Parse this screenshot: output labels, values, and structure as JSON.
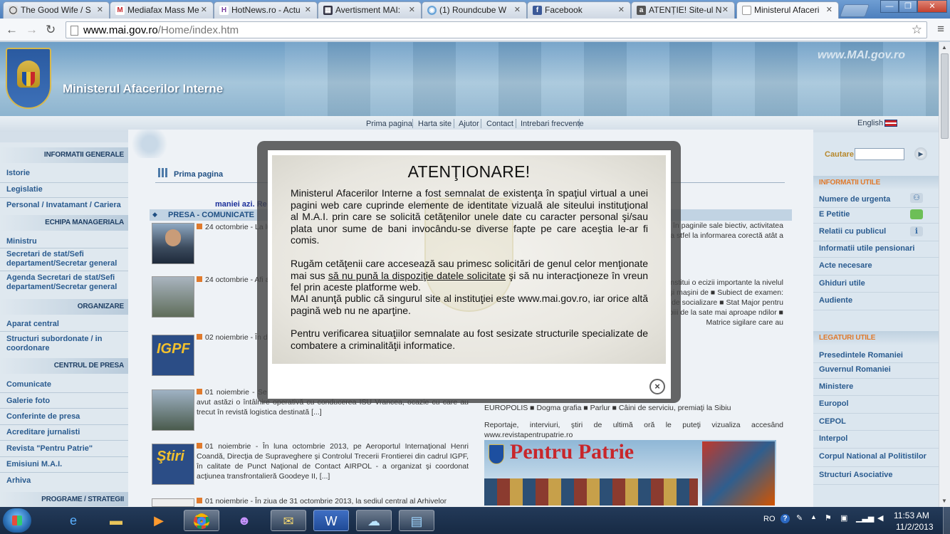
{
  "browser": {
    "tabs": [
      {
        "label": "The Good Wife / S",
        "icon": "speech-icon"
      },
      {
        "label": "Mediafax Mass Me",
        "icon": "gmail-icon"
      },
      {
        "label": "HotNews.ro - Actu",
        "icon": "hotnews-icon"
      },
      {
        "label": "Avertisment MAI:",
        "icon": "news-icon"
      },
      {
        "label": "(1) Roundcube W",
        "icon": "roundcube-icon"
      },
      {
        "label": "Facebook",
        "icon": "facebook-icon"
      },
      {
        "label": "ATENȚIE! Site-ul N",
        "icon": "a-icon"
      },
      {
        "label": "Ministerul Afaceri",
        "icon": "page-icon"
      }
    ],
    "url_host": "www.mai.gov.ro",
    "url_path": "/Home/index.htm"
  },
  "site": {
    "title": "Ministerul Afacerilor Interne",
    "mark": "www.MAI.gov.ro",
    "topnav": [
      "Prima pagina",
      "Harta site",
      "Ajutor",
      "Contact",
      "Intrebari frecvente"
    ],
    "language": "English"
  },
  "leftbar": {
    "h1": "INFORMATII GENERALE",
    "items1": [
      "Istorie",
      "Legislatie",
      "Personal / Invatamant / Cariera"
    ],
    "h2": "ECHIPA MANAGERIALA",
    "items2": [
      "Ministru",
      "Secretari de stat/Sefi departament/Secretar general",
      "Agenda Secretari de stat/Sefi departament/Secretar general"
    ],
    "h3": "ORGANIZARE",
    "items3": [
      "Aparat central",
      "Structuri subordonate / in coordonare"
    ],
    "h4": "CENTRUL DE PRESA",
    "items4": [
      "Comunicate",
      "Galerie foto",
      "Conferinte de presa",
      "Acreditare jurnalisti",
      "Revista \"Pentru Patrie\"",
      "Emisiuni M.A.I.",
      "Arhiva"
    ],
    "h5": "PROGRAME / STRATEGII"
  },
  "center": {
    "breadcrumb": "Prima pagina",
    "marquee": "maniei azi. Re",
    "press_heading": "PRESA - COMUNICATE",
    "news": [
      "24 octombrie - La lucrările Convocării Brigăzilor de Combat de Poliţie Transport",
      "24 octombrie - Afi a şefilor de poliţie d Centrul Chinologic antrenează câinii folo",
      "02 noiembrie - În dispărute sau pe nu au fost depistate activităţilor desfăşura",
      "01 noiembrie - Se şeful Inspectoratului General pentru Situaţii de Urgenţă au avut astăzi o întâlnire operativă cu conducerea ISU Vrancea, ocazie cu care au trecut în revistă logistica destinată [...]",
      "01 noiembrie - În luna octombrie 2013, pe Aeroportul Internaţional Henri Coandă, Direcţia de Supraveghere şi Controlul Trecerii Frontierei din cadrul IGPF, în calitate de Punct Naţional de Contact AIRPOL - a organizat şi coordonat acţiunea transfrontalieră Goodeye II, [...]",
      "01 noiembrie - În ziua de 31 octombrie 2013, la sediul central al Arhivelor"
    ],
    "rightcol": [
      "ă în 1949 - publicaţie centrală a erelor, prezintă în paginile sale biectiv, activitatea profesională a stfel la informarea corectă atât a",
      "3. ■ Editorial: Fără violenţă! ■ „Ţările Forumului pot constitui o ecizii importante la nivelul U.E.\" – ), secretar de stat în M.A.I. ■ M.A.I. cu tehnică şi maşini de ■ Subiect de examen: liniştea tuşe şi păduri aprinse ■ Hoţi de e pe reţeaua de socializare ■ Stat Major pentru gestionarea care salvează de la „accident\" ■ Copiii de la sate mai aproape ndilor ■ Matrice sigilare care au",
      "EUROPOLIS ■ Dogma grafia ■ Parlur ■ Câini de serviciu, premiaţi la Sibiu",
      "Reportaje, interviuri, ştiri de ultimă oră le puteţi vizualiza accesând www.revistapentrupatrie.ro"
    ],
    "pentru_patrie": "Pentru Patrie"
  },
  "rightbar": {
    "search_label": "Cautare",
    "h1": "INFORMATII UTILE",
    "items1": [
      "Numere de urgenta",
      "E Petitie",
      "Relatii cu publicul",
      "Informatii utile pensionari",
      "Acte necesare",
      "Ghiduri utile",
      "Audiente"
    ],
    "h2": "LEGATURI UTILE",
    "items2": [
      "Presedintele Romaniei",
      "Guvernul Romaniei",
      "Ministere",
      "Europol",
      "CEPOL",
      "Interpol",
      "Corpul National al Politistilor",
      "Structuri Asociative"
    ]
  },
  "modal": {
    "title": "ATENŢIONARE!",
    "p1": "Ministerul Afacerilor Interne a fost semnalat  de existenţa în spaţiul virtual a unei pagini web care cuprinde elemente de identitate vizuală ale siteului instituţional al M.A.I. prin care se solicită cetăţenilor unele date cu caracter personal şi/sau plata unor sume de bani invocându-se diverse fapte pe care aceştia le-ar fi comis.",
    "p2a": "Rugăm cetăţenii care accesează sau primesc solicitări de genul celor menţionate mai sus ",
    "p2u": "să nu pună la dispoziţie datele solicitate",
    "p2b": " şi să nu interacţioneze în vreun fel prin aceste platforme web.",
    "p3": "MAI anunţă public că singurul site al instituţiei este www.mai.gov.ro, iar orice altă pagină web nu ne aparţine.",
    "p4": "Pentru verificarea situaţiilor semnalate au fost sesizate structurile specializate de combatere a criminalităţii informatice.",
    "close": "×"
  },
  "taskbar": {
    "lang": "RO",
    "time": "11:53 AM",
    "date": "11/2/2013"
  }
}
